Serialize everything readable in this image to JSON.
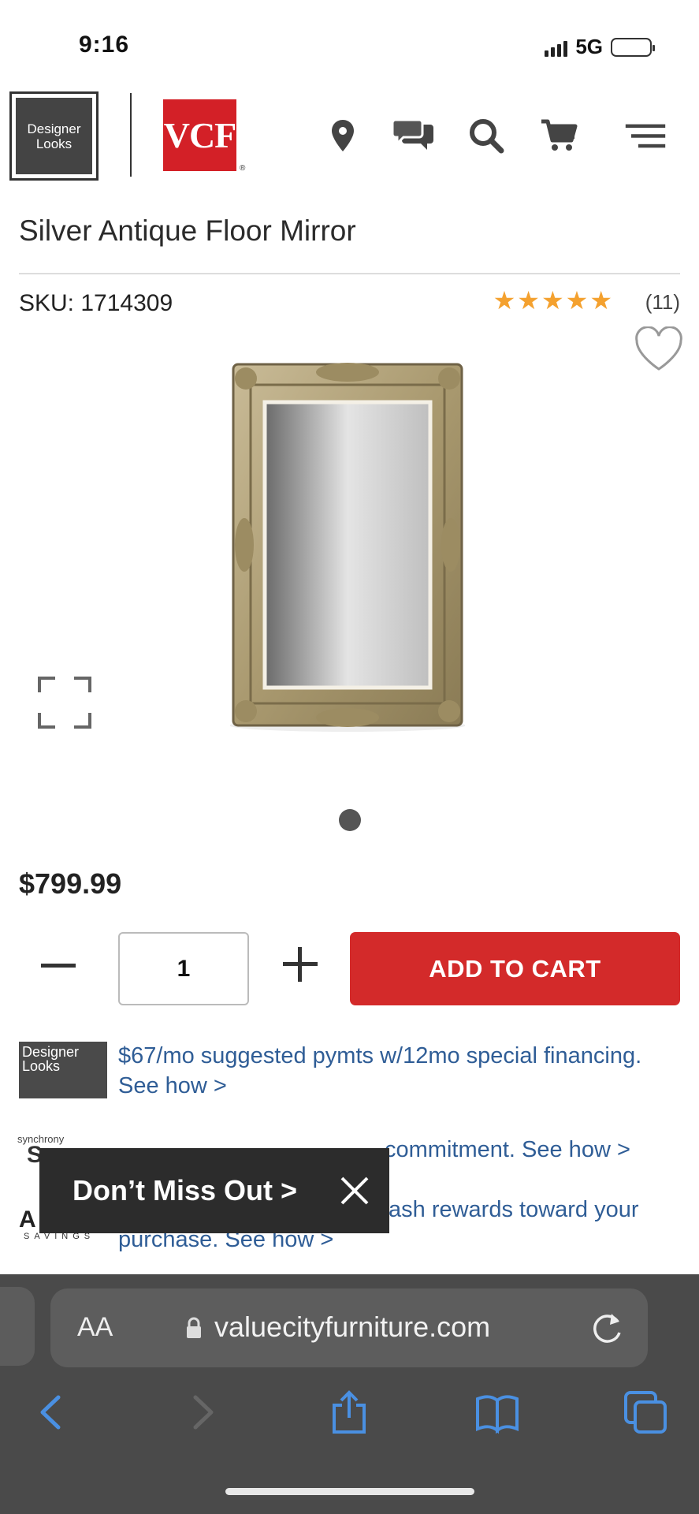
{
  "status_bar": {
    "time": "9:16",
    "network": "5G"
  },
  "header": {
    "designer_logo_text": "Designer Looks",
    "vcf_logo_text": "VCF",
    "icons": [
      "location-pin-icon",
      "chat-icon",
      "search-icon",
      "cart-icon",
      "menu-icon"
    ]
  },
  "product": {
    "title": "Silver Antique Floor Mirror",
    "sku": "SKU: 1714309",
    "rating_stars": 5,
    "review_count": "(11)",
    "price": "$799.99",
    "quantity": "1",
    "add_to_cart_label": "ADD TO CART",
    "image_count": 1,
    "current_image_index": 1
  },
  "financing": {
    "designer_card_text": "Designer Looks",
    "monthly_text": "$67/mo suggested pymts w/12mo special financing. See how >",
    "synchrony_label": "synchrony",
    "synchrony_letter": "S",
    "apr_text": "commitment. See how >",
    "savings_letter": "A",
    "savings_label": "SAVINGS",
    "cash_text": "ash rewards toward your",
    "purchase_text": "purchase. See how >"
  },
  "toast": {
    "label": "Don’t Miss Out >"
  },
  "browser": {
    "aa_label": "AA",
    "url": "valuecityfurniture.com",
    "toolbar_icons": [
      "back-icon",
      "forward-icon",
      "share-icon",
      "bookmarks-icon",
      "tabs-icon"
    ]
  },
  "colors": {
    "brand_red": "#d32a2a",
    "star": "#f4a12f",
    "link_blue": "#2f5d96"
  }
}
